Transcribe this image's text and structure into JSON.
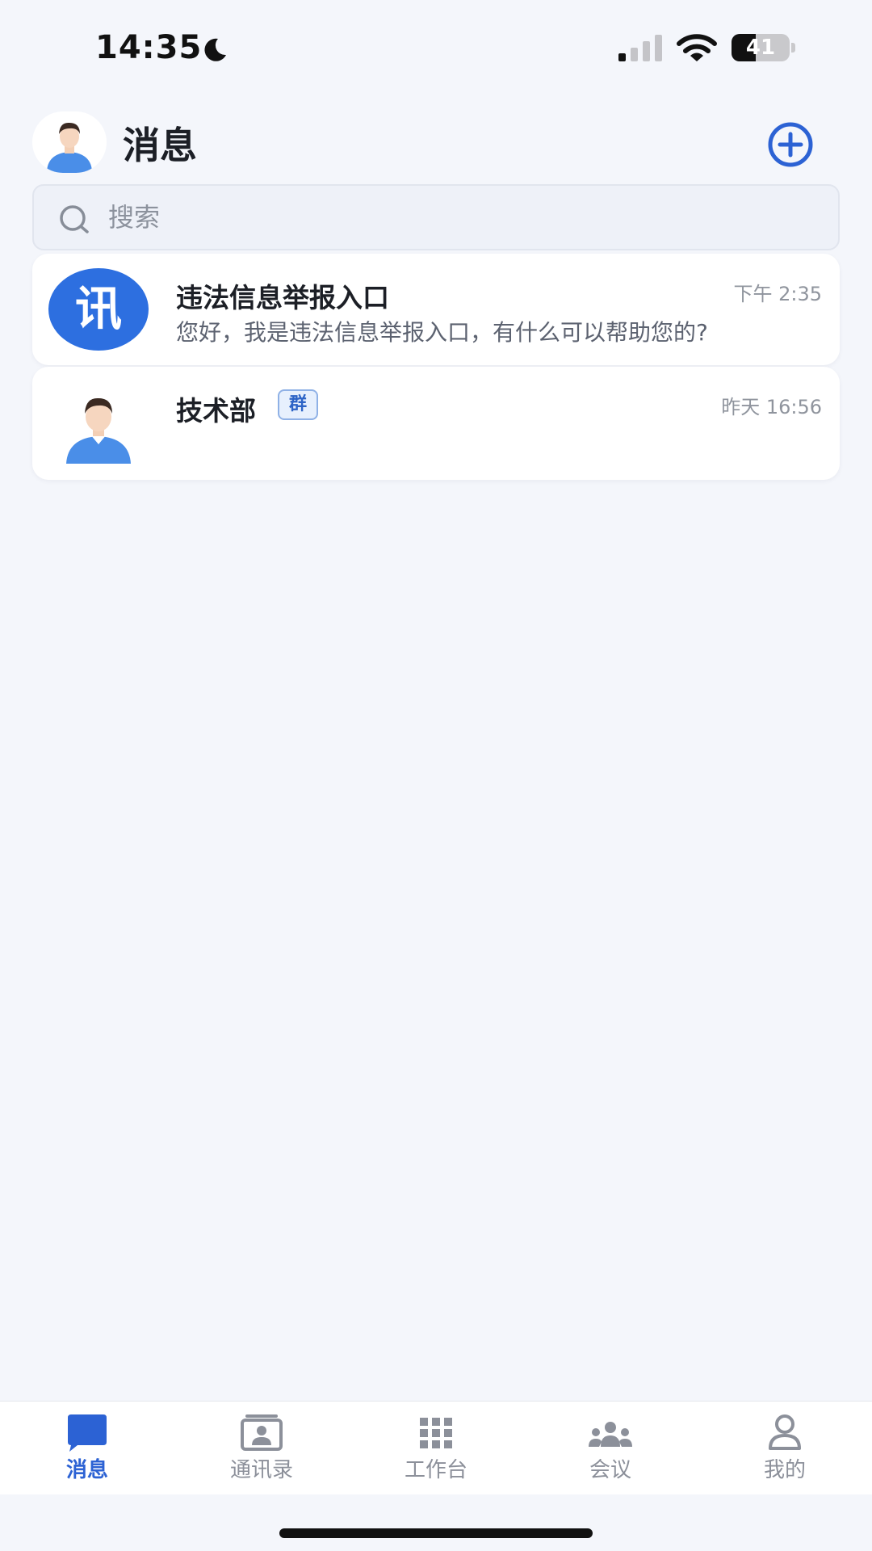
{
  "status_bar": {
    "time": "14:35",
    "battery": "41",
    "battery_level": 0.41
  },
  "header": {
    "title": "消息",
    "add_icon": "plus-circle-icon"
  },
  "search": {
    "placeholder": "搜索",
    "value": ""
  },
  "conversations": [
    {
      "name": "违法信息举报入口",
      "time": "下午 2:35",
      "preview": "您好，我是违法信息举报入口，有什么可以帮助您的?",
      "avatar_text": "讯",
      "avatar_color": "#2d6fe0"
    },
    {
      "name": "技术部",
      "badge": "群",
      "time": "昨天 16:56",
      "preview": ""
    }
  ],
  "tabs": [
    {
      "label": "消息",
      "icon": "message-icon",
      "active": true
    },
    {
      "label": "通讯录",
      "icon": "contacts-icon",
      "active": false
    },
    {
      "label": "工作台",
      "icon": "grid-icon",
      "active": false
    },
    {
      "label": "会议",
      "icon": "meeting-icon",
      "active": false
    },
    {
      "label": "我的",
      "icon": "profile-icon",
      "active": false
    }
  ],
  "colors": {
    "accent": "#2c62d4",
    "background": "#f4f6fb"
  }
}
